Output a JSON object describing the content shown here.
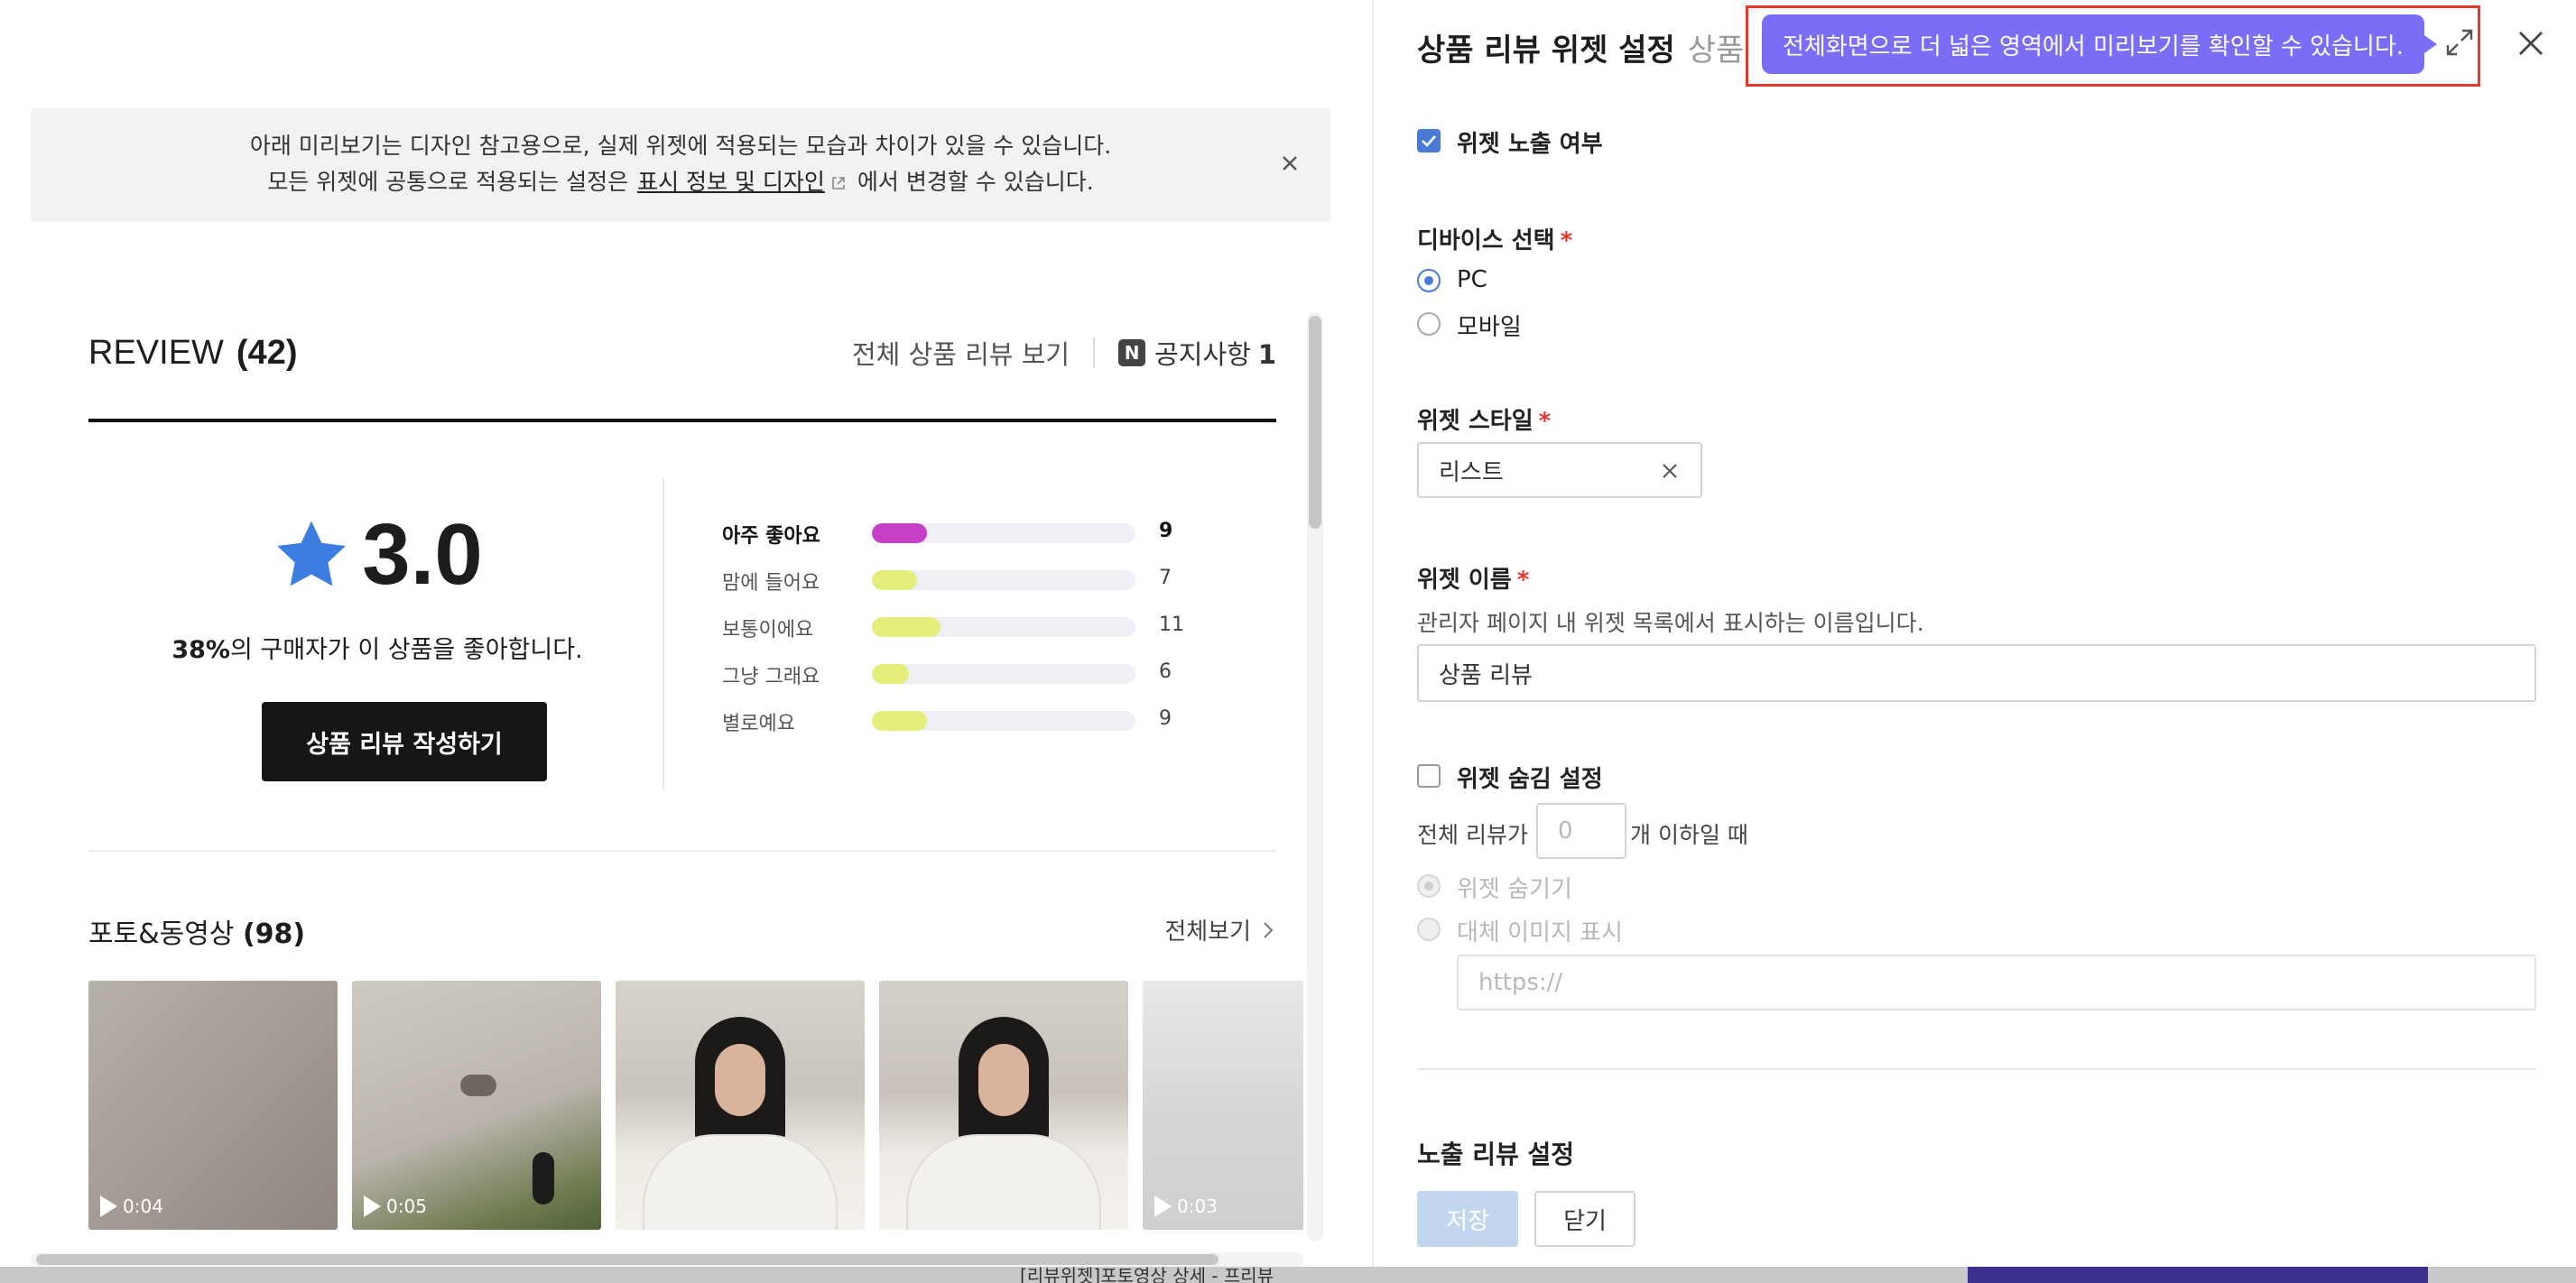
{
  "preview": {
    "notice_line1": "아래 미리보기는 디자인 참고용으로, 실제 위젯에 적용되는 모습과 차이가 있을 수 있습니다.",
    "notice_line2_pre": "모든 위젯에 공통으로 적용되는 설정은",
    "notice_link": "표시 정보 및 디자인",
    "notice_line2_post": "에서 변경할 수 있습니다.",
    "widget": {
      "title": "REVIEW",
      "count": "(42)",
      "all_reviews_link": "전체 상품 리뷰 보기",
      "notice_badge": "N",
      "notice_label": "공지사항",
      "notice_count": "1",
      "score": "3.0",
      "like_pct": "38%",
      "like_text": "의 구매자가 이 상품을 좋아합니다.",
      "write_button": "상품 리뷰 작성하기",
      "distribution": [
        {
          "label": "아주 좋아요",
          "count": "9",
          "fraction": 0.21,
          "color": "#c63fc9",
          "top": true
        },
        {
          "label": "맘에 들어요",
          "count": "7",
          "fraction": 0.17,
          "color": "#e4ee7a",
          "top": false
        },
        {
          "label": "보통이에요",
          "count": "11",
          "fraction": 0.26,
          "color": "#e4ee7a",
          "top": false
        },
        {
          "label": "그냥 그래요",
          "count": "6",
          "fraction": 0.14,
          "color": "#e4ee7a",
          "top": false
        },
        {
          "label": "별로예요",
          "count": "9",
          "fraction": 0.21,
          "color": "#e4ee7a",
          "top": false
        }
      ],
      "media_title": "포토&동영상",
      "media_count": "(98)",
      "see_all": "전체보기",
      "thumbnails": [
        {
          "duration": "0:04"
        },
        {
          "duration": "0:05"
        },
        {
          "duration": ""
        },
        {
          "duration": ""
        },
        {
          "duration": "0:03"
        }
      ]
    },
    "bottom_strip_text": "[리뷰위젯]포토영상 상세 - 프리뷰"
  },
  "panel": {
    "title": "상품 리뷰 위젯 설정",
    "title_sub": "상품",
    "tooltip": "전체화면으로 더 넓은 영역에서 미리보기를 확인할 수 있습니다.",
    "widget_visible_label": "위젯 노출 여부",
    "device_label": "디바이스 선택",
    "required_mark": "*",
    "device_options": [
      "PC",
      "모바일"
    ],
    "style_label": "위젯 스타일",
    "style_value": "리스트",
    "name_label": "위젯 이름",
    "name_help": "관리자 페이지 내 위젯 목록에서 표시하는 이름입니다.",
    "name_value": "상품 리뷰",
    "hide_label": "위젯 숨김 설정",
    "hide_pre": "전체 리뷰가",
    "hide_placeholder": "0",
    "hide_post": "개 이하일 때",
    "hide_options": [
      "위젯 숨기기",
      "대체 이미지 표시"
    ],
    "url_placeholder": "https://",
    "exposure_label": "노출 리뷰 설정",
    "save_button": "저장",
    "close_button": "닫기"
  },
  "colors": {
    "accent": "#4a7ad6",
    "tooltip": "#7b6ef6",
    "highlight_box": "#e3392f",
    "star": "#3b7de0"
  }
}
